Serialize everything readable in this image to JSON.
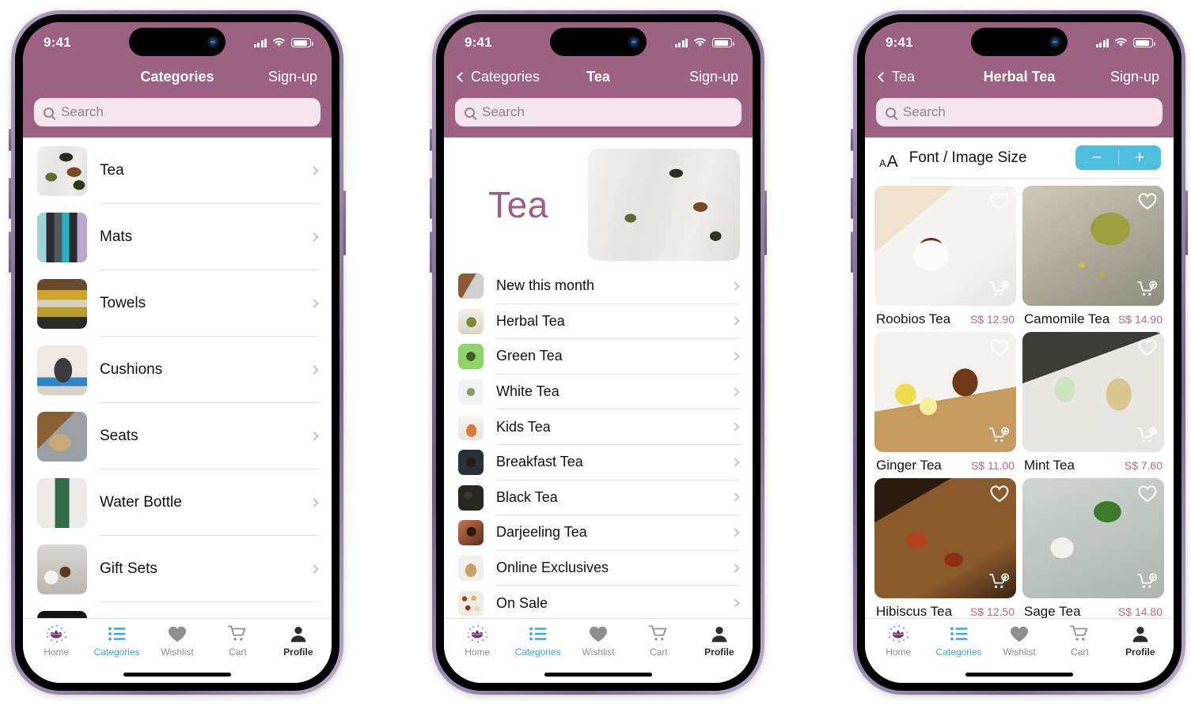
{
  "status_bar": {
    "time": "9:41",
    "signal_icon": "cellular-bars-icon",
    "wifi_icon": "wifi-icon",
    "battery_icon": "battery-icon"
  },
  "theme": {
    "brand_mauve": "#9d6182",
    "search_field": "#f4e4ec",
    "accent_blue": "#3aa8e0",
    "stepper_blue": "#4ebdde",
    "price_pink": "#b06a8d",
    "hero_title": "#a05d83"
  },
  "tabbar": {
    "items": [
      {
        "label": "Home",
        "icon": "lotus-logo-icon",
        "state": "normal"
      },
      {
        "label": "Categories",
        "icon": "list-icon",
        "state": "active"
      },
      {
        "label": "Wishlist",
        "icon": "heart-icon",
        "state": "normal"
      },
      {
        "label": "Cart",
        "icon": "cart-icon",
        "state": "normal"
      },
      {
        "label": "Profile",
        "icon": "person-icon",
        "state": "strong"
      }
    ]
  },
  "search": {
    "placeholder": "Search",
    "icon": "search-icon",
    "value": ""
  },
  "phone1": {
    "nav": {
      "title": "Categories",
      "action": "Sign-up"
    },
    "items": [
      {
        "label": "Tea",
        "thumb": "tea-spoons-photo"
      },
      {
        "label": "Mats",
        "thumb": "yoga-mats-photo"
      },
      {
        "label": "Towels",
        "thumb": "folded-towels-photo"
      },
      {
        "label": "Cushions",
        "thumb": "meditation-cushion-photo"
      },
      {
        "label": "Seats",
        "thumb": "wooden-seats-photo"
      },
      {
        "label": "Water Bottle",
        "thumb": "green-bottle-photo"
      },
      {
        "label": "Gift Sets",
        "thumb": "gift-set-photo"
      },
      {
        "label": "",
        "thumb": "partial-photo"
      }
    ]
  },
  "phone2": {
    "nav": {
      "back": "Categories",
      "title": "Tea",
      "action": "Sign-up"
    },
    "hero": {
      "title": "Tea",
      "image": "tea-spoons-photo"
    },
    "items": [
      {
        "label": "New this month",
        "thumb": "new-arrivals-photo"
      },
      {
        "label": "Herbal Tea",
        "thumb": "herbal-tea-photo"
      },
      {
        "label": "Green Tea",
        "thumb": "green-tea-photo"
      },
      {
        "label": "White Tea",
        "thumb": "white-tea-photo"
      },
      {
        "label": "Kids Tea",
        "thumb": "kids-tea-photo"
      },
      {
        "label": "Breakfast Tea",
        "thumb": "breakfast-tea-photo"
      },
      {
        "label": "Black Tea",
        "thumb": "black-tea-photo"
      },
      {
        "label": "Darjeeling Tea",
        "thumb": "darjeeling-tea-photo"
      },
      {
        "label": "Online Exclusives",
        "thumb": "online-exclusives-photo"
      },
      {
        "label": "On Sale",
        "thumb": "on-sale-photo"
      }
    ]
  },
  "phone3": {
    "nav": {
      "back": "Tea",
      "title": "Herbal Tea",
      "action": "Sign-up"
    },
    "font_size": {
      "icon": "aa-text-size-icon",
      "label": "Font / Image Size",
      "decrease": "−",
      "increase": "+"
    },
    "products": [
      {
        "name": "Roobios Tea",
        "price": "S$ 12.90",
        "image": "roobios-tea-photo",
        "wishlist_icon": "heart-outline-icon",
        "cart_icon": "cart-plus-icon"
      },
      {
        "name": "Camomile Tea",
        "price": "S$ 14.90",
        "image": "camomile-tea-photo",
        "wishlist_icon": "heart-outline-icon",
        "cart_icon": "cart-plus-icon"
      },
      {
        "name": "Ginger Tea",
        "price": "S$ 11.00",
        "image": "ginger-tea-photo",
        "wishlist_icon": "heart-outline-icon",
        "cart_icon": "cart-plus-icon"
      },
      {
        "name": "Mint Tea",
        "price": "S$ 7.60",
        "image": "mint-tea-photo",
        "wishlist_icon": "heart-outline-icon",
        "cart_icon": "cart-plus-icon"
      },
      {
        "name": "Hibiscus Tea",
        "price": "S$ 12.50",
        "image": "hibiscus-tea-photo",
        "wishlist_icon": "heart-outline-icon",
        "cart_icon": "cart-plus-icon"
      },
      {
        "name": "Sage Tea",
        "price": "S$ 14.80",
        "image": "sage-tea-photo",
        "wishlist_icon": "heart-outline-icon",
        "cart_icon": "cart-plus-icon"
      }
    ]
  }
}
